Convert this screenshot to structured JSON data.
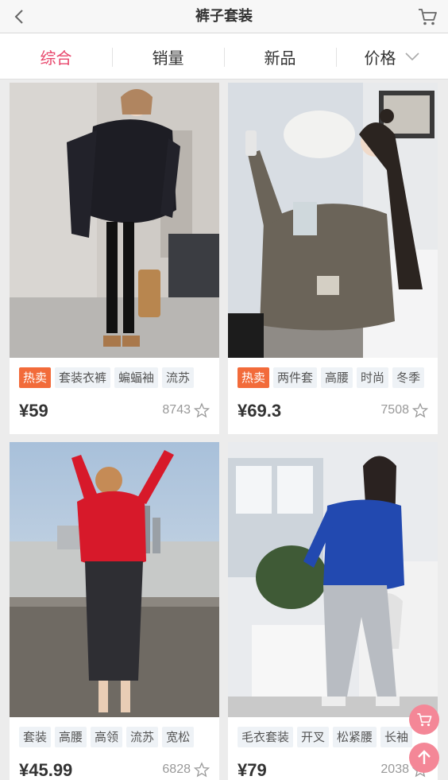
{
  "header": {
    "title": "裤子套装",
    "back_icon": "chevron-left-icon",
    "cart_icon": "cart-icon"
  },
  "tabs": [
    {
      "label": "综合",
      "active": true
    },
    {
      "label": "销量",
      "active": false
    },
    {
      "label": "新品",
      "active": false
    },
    {
      "label": "价格",
      "active": false,
      "icon": "chevron-down-icon"
    }
  ],
  "colors": {
    "accent": "#e8466b",
    "hot_tag": "#f26b3a",
    "tag_bg": "#eef2f6",
    "float_button": "#f48797"
  },
  "products": [
    {
      "tags": [
        {
          "label": "热卖",
          "hot": true
        },
        {
          "label": "套装衣裤"
        },
        {
          "label": "蝙蝠袖"
        },
        {
          "label": "流苏"
        }
      ],
      "price": "¥59",
      "sales": "8743"
    },
    {
      "tags": [
        {
          "label": "热卖",
          "hot": true
        },
        {
          "label": "两件套"
        },
        {
          "label": "高腰"
        },
        {
          "label": "时尚"
        },
        {
          "label": "冬季"
        }
      ],
      "price": "¥69.3",
      "sales": "7508"
    },
    {
      "tags": [
        {
          "label": "套装"
        },
        {
          "label": "高腰"
        },
        {
          "label": "高领"
        },
        {
          "label": "流苏"
        },
        {
          "label": "宽松"
        }
      ],
      "price": "¥45.99",
      "sales": "6828"
    },
    {
      "tags": [
        {
          "label": "毛衣套装"
        },
        {
          "label": "开叉"
        },
        {
          "label": "松紧腰"
        },
        {
          "label": "长袖"
        }
      ],
      "price": "¥79",
      "sales": "2038"
    }
  ],
  "floating": {
    "cart_icon": "cart-icon",
    "top_icon": "arrow-up-icon"
  }
}
